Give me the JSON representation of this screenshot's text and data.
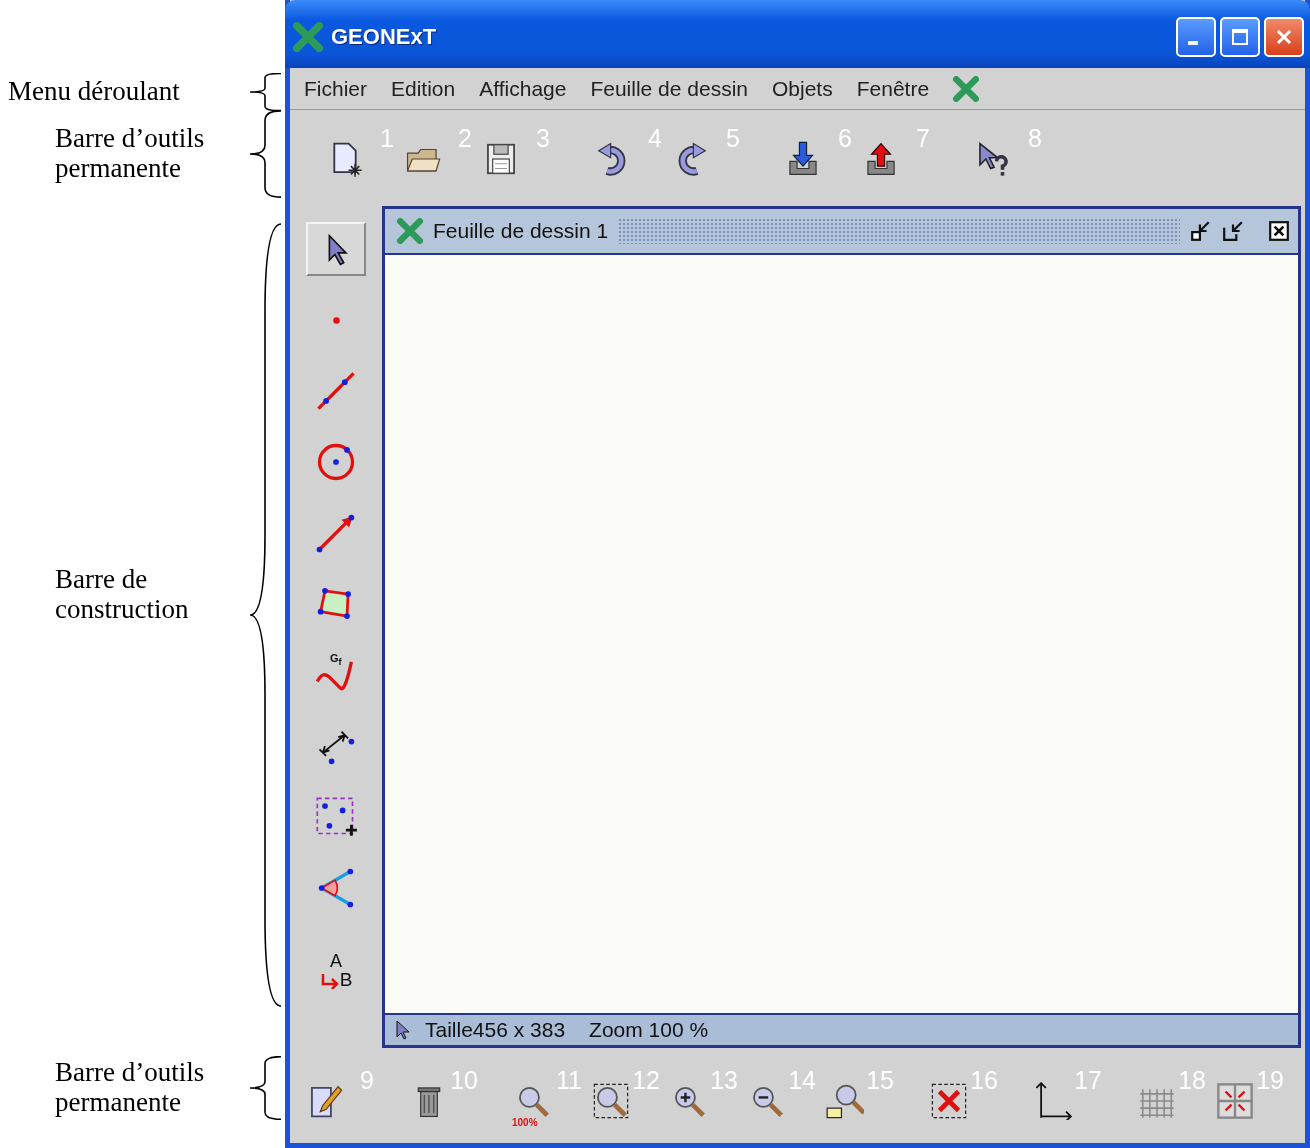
{
  "window": {
    "title": "GEONExT"
  },
  "annotations": [
    {
      "text": "Menu déroulant"
    },
    {
      "text": "Barre d’outils permanente"
    },
    {
      "text": "Barre de construction"
    },
    {
      "text": "Barre d’outils permanente"
    }
  ],
  "menu": [
    "Fichier",
    "Edition",
    "Affichage",
    "Feuille de dessin",
    "Objets",
    "Fenêtre"
  ],
  "top_toolbar": [
    [
      {
        "number": "1"
      },
      {
        "number": "2"
      },
      {
        "number": "3"
      }
    ],
    [
      {
        "number": "4"
      },
      {
        "number": "5"
      }
    ],
    [
      {
        "number": "6"
      },
      {
        "number": "7"
      }
    ],
    [
      {
        "number": "8"
      }
    ]
  ],
  "construction_tools": [
    {
      "selected": true
    },
    {
      "selected": false
    },
    {
      "selected": false
    },
    {
      "selected": false
    },
    {
      "selected": false
    },
    {
      "selected": false
    },
    {
      "selected": false,
      "caption": "G$_{f}$"
    },
    {
      "selected": false
    },
    {
      "selected": false
    },
    {
      "selected": false
    },
    {
      "selected": false,
      "letters": [
        "A",
        "B"
      ]
    }
  ],
  "sheet": {
    "title": "Feuille de dessin 1",
    "size": "Taille456 x 383",
    "zoom": "Zoom 100 %"
  },
  "bottom_toolbar": [
    [
      {
        "number": "9"
      }
    ],
    [
      {
        "number": "10"
      }
    ],
    [
      {
        "number": "11",
        "caption": "100%"
      },
      {
        "number": "12"
      },
      {
        "number": "13"
      },
      {
        "number": "14"
      },
      {
        "number": "15"
      }
    ],
    [
      {
        "number": "16"
      }
    ],
    [
      {
        "number": "17"
      }
    ],
    [
      {
        "number": "18"
      },
      {
        "number": "19"
      }
    ]
  ]
}
